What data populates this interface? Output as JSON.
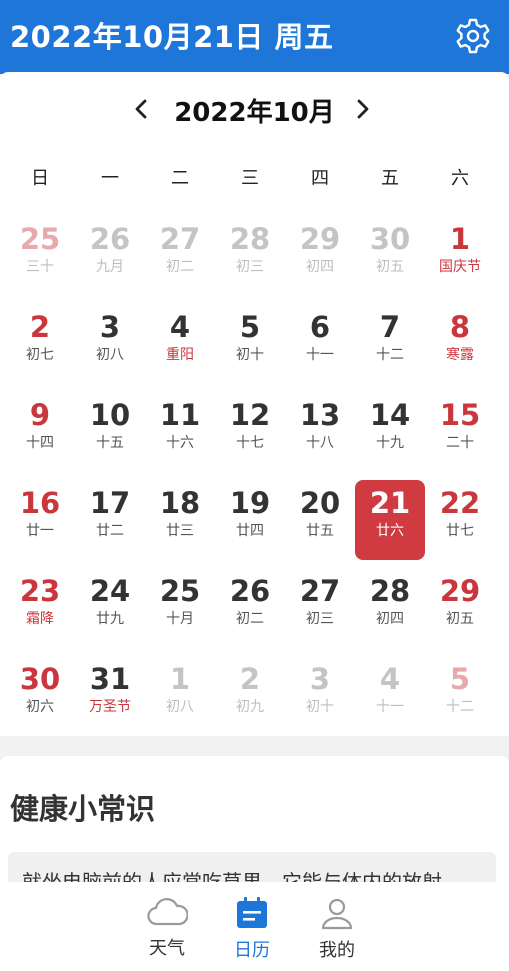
{
  "header": {
    "title": "2022年10月21日 周五",
    "settings_icon": "gear-icon"
  },
  "calendar": {
    "month_label": "2022年10月",
    "prev_icon": "chevron-left-icon",
    "next_icon": "chevron-right-icon",
    "weekdays": [
      "日",
      "一",
      "二",
      "三",
      "四",
      "五",
      "六"
    ],
    "weeks": [
      [
        {
          "day": "25",
          "lunar": "三十",
          "other": true
        },
        {
          "day": "26",
          "lunar": "九月",
          "other": true
        },
        {
          "day": "27",
          "lunar": "初二",
          "other": true
        },
        {
          "day": "28",
          "lunar": "初三",
          "other": true
        },
        {
          "day": "29",
          "lunar": "初四",
          "other": true
        },
        {
          "day": "30",
          "lunar": "初五",
          "other": true
        },
        {
          "day": "1",
          "lunar": "国庆节",
          "holiday": true
        }
      ],
      [
        {
          "day": "2",
          "lunar": "初七"
        },
        {
          "day": "3",
          "lunar": "初八"
        },
        {
          "day": "4",
          "lunar": "重阳",
          "holiday": true
        },
        {
          "day": "5",
          "lunar": "初十"
        },
        {
          "day": "6",
          "lunar": "十一"
        },
        {
          "day": "7",
          "lunar": "十二"
        },
        {
          "day": "8",
          "lunar": "寒露",
          "holiday": true
        }
      ],
      [
        {
          "day": "9",
          "lunar": "十四"
        },
        {
          "day": "10",
          "lunar": "十五"
        },
        {
          "day": "11",
          "lunar": "十六"
        },
        {
          "day": "12",
          "lunar": "十七"
        },
        {
          "day": "13",
          "lunar": "十八"
        },
        {
          "day": "14",
          "lunar": "十九"
        },
        {
          "day": "15",
          "lunar": "二十"
        }
      ],
      [
        {
          "day": "16",
          "lunar": "廿一"
        },
        {
          "day": "17",
          "lunar": "廿二"
        },
        {
          "day": "18",
          "lunar": "廿三"
        },
        {
          "day": "19",
          "lunar": "廿四"
        },
        {
          "day": "20",
          "lunar": "廿五"
        },
        {
          "day": "21",
          "lunar": "廿六",
          "selected": true
        },
        {
          "day": "22",
          "lunar": "廿七"
        }
      ],
      [
        {
          "day": "23",
          "lunar": "霜降",
          "holiday": true
        },
        {
          "day": "24",
          "lunar": "廿九"
        },
        {
          "day": "25",
          "lunar": "十月"
        },
        {
          "day": "26",
          "lunar": "初二"
        },
        {
          "day": "27",
          "lunar": "初三"
        },
        {
          "day": "28",
          "lunar": "初四"
        },
        {
          "day": "29",
          "lunar": "初五"
        }
      ],
      [
        {
          "day": "30",
          "lunar": "初六"
        },
        {
          "day": "31",
          "lunar": "万圣节",
          "holiday": true
        },
        {
          "day": "1",
          "lunar": "初八",
          "other": true
        },
        {
          "day": "2",
          "lunar": "初九",
          "other": true
        },
        {
          "day": "3",
          "lunar": "初十",
          "other": true
        },
        {
          "day": "4",
          "lunar": "十一",
          "other": true
        },
        {
          "day": "5",
          "lunar": "十二",
          "other": true
        }
      ]
    ]
  },
  "health": {
    "title": "健康小常识",
    "tip": "就坐电脑前的人应常吃草果，它能与体内的放射"
  },
  "bottom_nav": {
    "tabs": [
      {
        "label": "天气",
        "icon": "cloud-icon",
        "active": false
      },
      {
        "label": "日历",
        "icon": "calendar-icon",
        "active": true
      },
      {
        "label": "我的",
        "icon": "user-icon",
        "active": false
      }
    ]
  },
  "colors": {
    "header_blue": "#1d76d8",
    "weekend_red": "#c9363c",
    "selected_red": "#cf3b41"
  }
}
